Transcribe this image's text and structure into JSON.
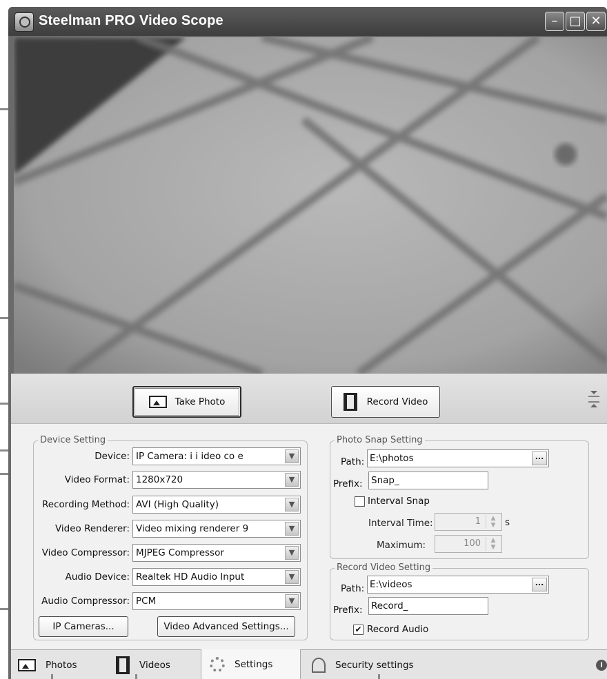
{
  "window": {
    "title": "Steelman PRO Video Scope",
    "controls": {
      "minimize": "–",
      "maximize": "□",
      "close": "✕"
    }
  },
  "toolbar": {
    "take_photo": "Take Photo",
    "record_video": "Record Video"
  },
  "device_setting": {
    "legend": "Device Setting",
    "device_label": "Device:",
    "device_value": "IP Camera:   i  i  ideo  co e",
    "video_format_label": "Video Format:",
    "video_format_value": "1280x720",
    "recording_method_label": "Recording Method:",
    "recording_method_value": "AVI (High Quality)",
    "video_renderer_label": "Video Renderer:",
    "video_renderer_value": "Video mixing renderer 9",
    "video_compressor_label": "Video Compressor:",
    "video_compressor_value": "MJPEG Compressor",
    "audio_device_label": "Audio Device:",
    "audio_device_value": "Realtek HD Audio Input",
    "audio_compressor_label": "Audio Compressor:",
    "audio_compressor_value": "PCM",
    "ip_cameras_button": "IP Cameras...",
    "advanced_button": "Video Advanced Settings..."
  },
  "photo_snap": {
    "legend": "Photo Snap Setting",
    "path_label": "Path:",
    "path_value": "E:\\photos",
    "browse": "...",
    "prefix_label": "Prefix:",
    "prefix_value": "Snap_",
    "interval_snap_label": "Interval Snap",
    "interval_snap_checked": false,
    "interval_time_label": "Interval Time:",
    "interval_time_value": "1",
    "interval_time_unit": "s",
    "maximum_label": "Maximum:",
    "maximum_value": "100"
  },
  "record_video": {
    "legend": "Record Video Setting",
    "path_label": "Path:",
    "path_value": "E:\\videos",
    "browse": "...",
    "prefix_label": "Prefix:",
    "prefix_value": "Record_",
    "record_audio_label": "Record Audio",
    "record_audio_checked": true,
    "check_mark": "✔"
  },
  "tabs": [
    {
      "label": "Photos",
      "icon": "photo-icon"
    },
    {
      "label": "Videos",
      "icon": "film-icon"
    },
    {
      "label": "Settings",
      "icon": "gear-icon"
    },
    {
      "label": "Security settings",
      "icon": "antenna-icon"
    }
  ],
  "active_tab": "Settings",
  "icons": {
    "info": "i",
    "spin_up": "▲",
    "spin_down": "▼",
    "dropdown": "▼"
  },
  "colors": {
    "titlebar": "#4a4a4a",
    "panel": "#f1f1f1",
    "callout": "#8a8a8a"
  }
}
